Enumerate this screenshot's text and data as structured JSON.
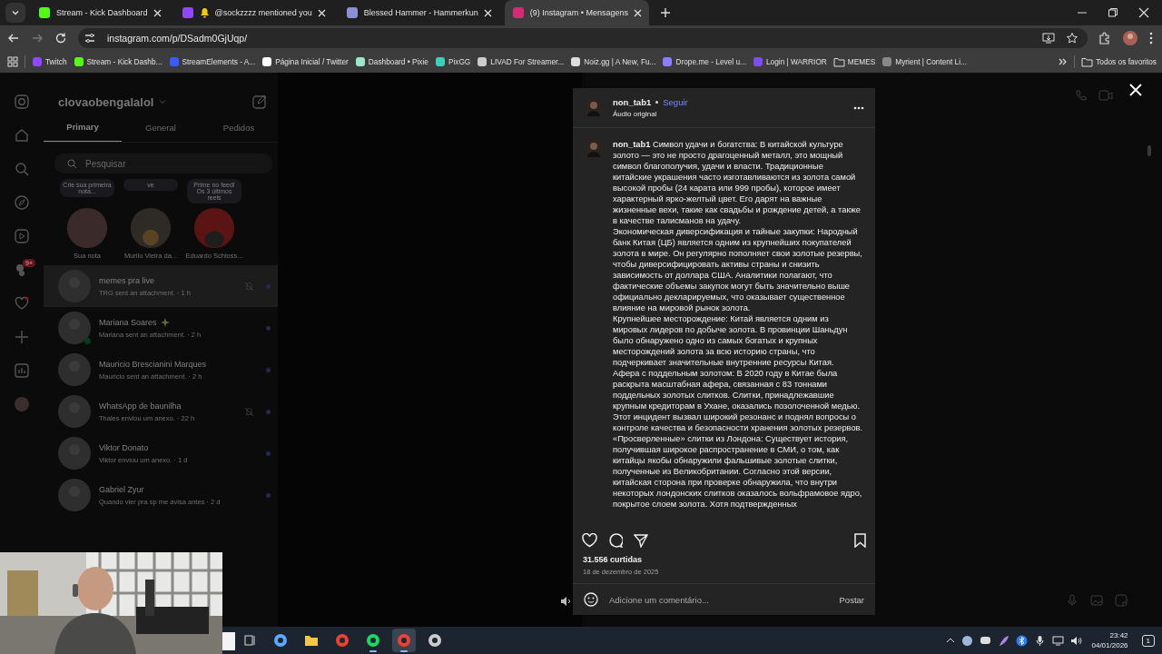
{
  "browser": {
    "tabs": [
      {
        "title": "Stream - Kick Dashboard",
        "kind": "kick",
        "notification": false,
        "selected": false
      },
      {
        "title": "@sockzzzz mentioned you",
        "kind": "twitch",
        "notification": true,
        "selected": false
      },
      {
        "title": "Blessed Hammer - Hammerkun",
        "kind": "shield",
        "notification": false,
        "selected": false
      },
      {
        "title": "(9) Instagram • Mensagens",
        "kind": "instagram",
        "notification": false,
        "selected": true
      }
    ],
    "address": "instagram.com/p/DSadm0GjUqp/",
    "bookmarks": [
      {
        "label": "Twitch",
        "kind": "twitch"
      },
      {
        "label": "Stream - Kick Dashb...",
        "kind": "kick"
      },
      {
        "label": "StreamElements - A...",
        "kind": "streamelements"
      },
      {
        "label": "Página Inicial / Twitter",
        "kind": "x"
      },
      {
        "label": "Dashboard • Pixie",
        "kind": "pixie"
      },
      {
        "label": "PixGG",
        "kind": "pixgg"
      },
      {
        "label": "LIVAD For Streamer...",
        "kind": "livad"
      },
      {
        "label": "Noiz.gg | A New, Fu...",
        "kind": "dot"
      },
      {
        "label": "Drope.me - Level u...",
        "kind": "drope"
      },
      {
        "label": "Login | WARRIOR",
        "kind": "warrior"
      },
      {
        "label": "MEMES",
        "kind": "folder"
      },
      {
        "label": "Myrient | Content Li...",
        "kind": "myrient"
      }
    ],
    "all_bookmarks": "Todos os favoritos"
  },
  "instagram": {
    "account": "clovaobengalalol",
    "messages_badge": "9+",
    "tabs": [
      {
        "label": "Primary",
        "selected": true
      },
      {
        "label": "General",
        "selected": false
      },
      {
        "label": "Pedidos",
        "selected": false
      }
    ],
    "search": {
      "placeholder": "Pesquisar"
    },
    "notes": [
      {
        "bubble": "Crie sua primeira nota...",
        "name": "Sua nota",
        "kind": "own"
      },
      {
        "bubble": "ve",
        "name": "Murilo Vieira da...",
        "kind": "sunset"
      },
      {
        "bubble": "Prime no feed! Os 3 últimos reels",
        "name": "Eduardo Schloss...",
        "kind": "red"
      }
    ],
    "chats": [
      {
        "name": "memes pra live",
        "preview": "TRG sent an attachment. · 1 h",
        "selected": true,
        "muted": true,
        "online": false,
        "sparkle": false
      },
      {
        "name": "Mariana Soares",
        "preview": "Mariana sent an attachment. · 2 h",
        "selected": false,
        "muted": false,
        "online": true,
        "sparkle": true
      },
      {
        "name": "Mauricio Brescianini Marques",
        "preview": "Mauricio sent an attachment. · 2 h",
        "selected": false,
        "muted": false,
        "online": false,
        "sparkle": false
      },
      {
        "name": "WhatsApp de baunilha",
        "preview": "Thales enviou um anexo. · 22 h",
        "selected": false,
        "muted": true,
        "online": false,
        "sparkle": false
      },
      {
        "name": "Viktor Donato",
        "preview": "Viktor enviou um anexo. · 1 d",
        "selected": false,
        "muted": false,
        "online": false,
        "sparkle": false
      },
      {
        "name": "Gabriel Zyur",
        "preview": "Quando vier pra sp me avisa antes · 2 d",
        "selected": false,
        "muted": false,
        "online": false,
        "sparkle": false
      }
    ]
  },
  "post": {
    "author": "non_tab1",
    "follow": "Seguir",
    "audio": "Áudio original",
    "caption": [
      "**non_tab1** Символ удачи и богатства: В китайской культуре золото — это не просто драгоценный металл, это мощный символ благополучия, удачи и власти. Традиционные китайские украшения часто изготавливаются из золота самой высокой пробы (24 карата или 999 пробы), которое имеет характерный ярко-желтый цвет. Его дарят на важные жизненные вехи, такие как свадьбы и рождение детей, а также в качестве талисманов на удачу.",
      "Экономическая диверсификация и тайные закупки: Народный банк Китая (ЦБ) является одним из крупнейших покупателей золота в мире. Он регулярно пополняет свои золотые резервы, чтобы диверсифицировать активы страны и снизить зависимость от доллара США. Аналитики полагают, что фактические объемы закупок могут быть значительно выше официально декларируемых, что оказывает существенное влияние на мировой рынок золота.",
      "Крупнейшее месторождение: Китай является одним из мировых лидеров по добыче золота. В провинции Шаньдун было обнаружено одно из самых богатых и крупных месторождений золота за всю историю страны, что подчеркивает значительные внутренние ресурсы Китая.",
      "Афера с поддельным золотом: В 2020 году в Китае была раскрыта масштабная афера, связанная с 83 тоннами поддельных золотых слитков. Слитки, принадлежавшие крупным кредиторам в Ухане, оказались позолоченной медью. Этот инцидент вызвал широкий резонанс и поднял вопросы о контроле качества и безопасности хранения золотых резервов.",
      "«Просверленные» слитки из Лондона: Существует история, получившая широкое распространение в СМИ, о том, как китайцы якобы обнаружили фальшивые золотые слитки, полученные из Великобритании. Согласно этой версии, китайская сторона при проверке обнаружила, что внутри некоторых лондонских слитков оказалось вольфрамовое ядро, покрытое слоем золота. Хотя подтвержденных"
    ],
    "likes": "31.556 curtidas",
    "date": "18 de dezembro de 2025",
    "comment": {
      "placeholder": "Adicione um comentário..."
    },
    "submit": "Postar"
  },
  "taskbar": {
    "apps": [
      {
        "kind": "taskview",
        "running": false,
        "selected": false
      },
      {
        "kind": "copilot",
        "running": false,
        "selected": false
      },
      {
        "kind": "files",
        "running": false,
        "selected": false
      },
      {
        "kind": "chrome",
        "running": false,
        "selected": false
      },
      {
        "kind": "spotify",
        "running": true,
        "selected": false
      },
      {
        "kind": "chrome",
        "running": true,
        "selected": true
      },
      {
        "kind": "obs",
        "running": false,
        "selected": false
      }
    ],
    "time": "23:42",
    "date": "04/01/2026",
    "notifications": "1"
  }
}
